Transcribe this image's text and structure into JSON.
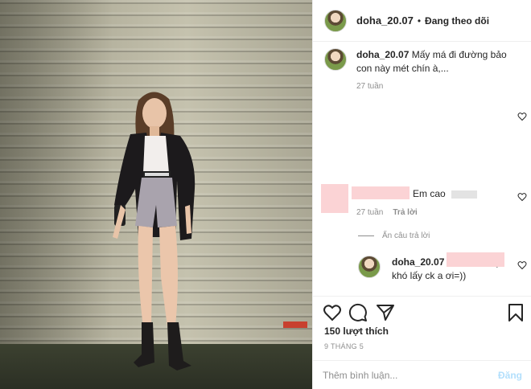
{
  "header": {
    "username": "doha_20.07",
    "separator": "•",
    "follow_status": "Đang theo dõi"
  },
  "caption": {
    "username": "doha_20.07",
    "text": "Mấy má đi đường bảo con này mét chín à,...",
    "time": "27 tuần"
  },
  "comment1": {
    "text": "Em cao",
    "time": "27 tuần",
    "reply_label": "Trả lời"
  },
  "replies_toggle": {
    "label": "Ẩn câu trả lời"
  },
  "reply1": {
    "username": "doha_20.07",
    "text": "cao như này khó lấy ck a ơi=))"
  },
  "actions": {
    "likes": "150 lượt thích",
    "date": "9 THÁNG 5",
    "icons": [
      "heart-icon",
      "comment-icon",
      "share-icon",
      "bookmark-icon"
    ]
  },
  "add_comment": {
    "placeholder": "Thêm bình luận...",
    "post_label": "Đăng"
  },
  "colors": {
    "link_disabled": "#b2dffc",
    "redaction": "#fbd3d5",
    "meta_gray": "#8e8e8e"
  }
}
